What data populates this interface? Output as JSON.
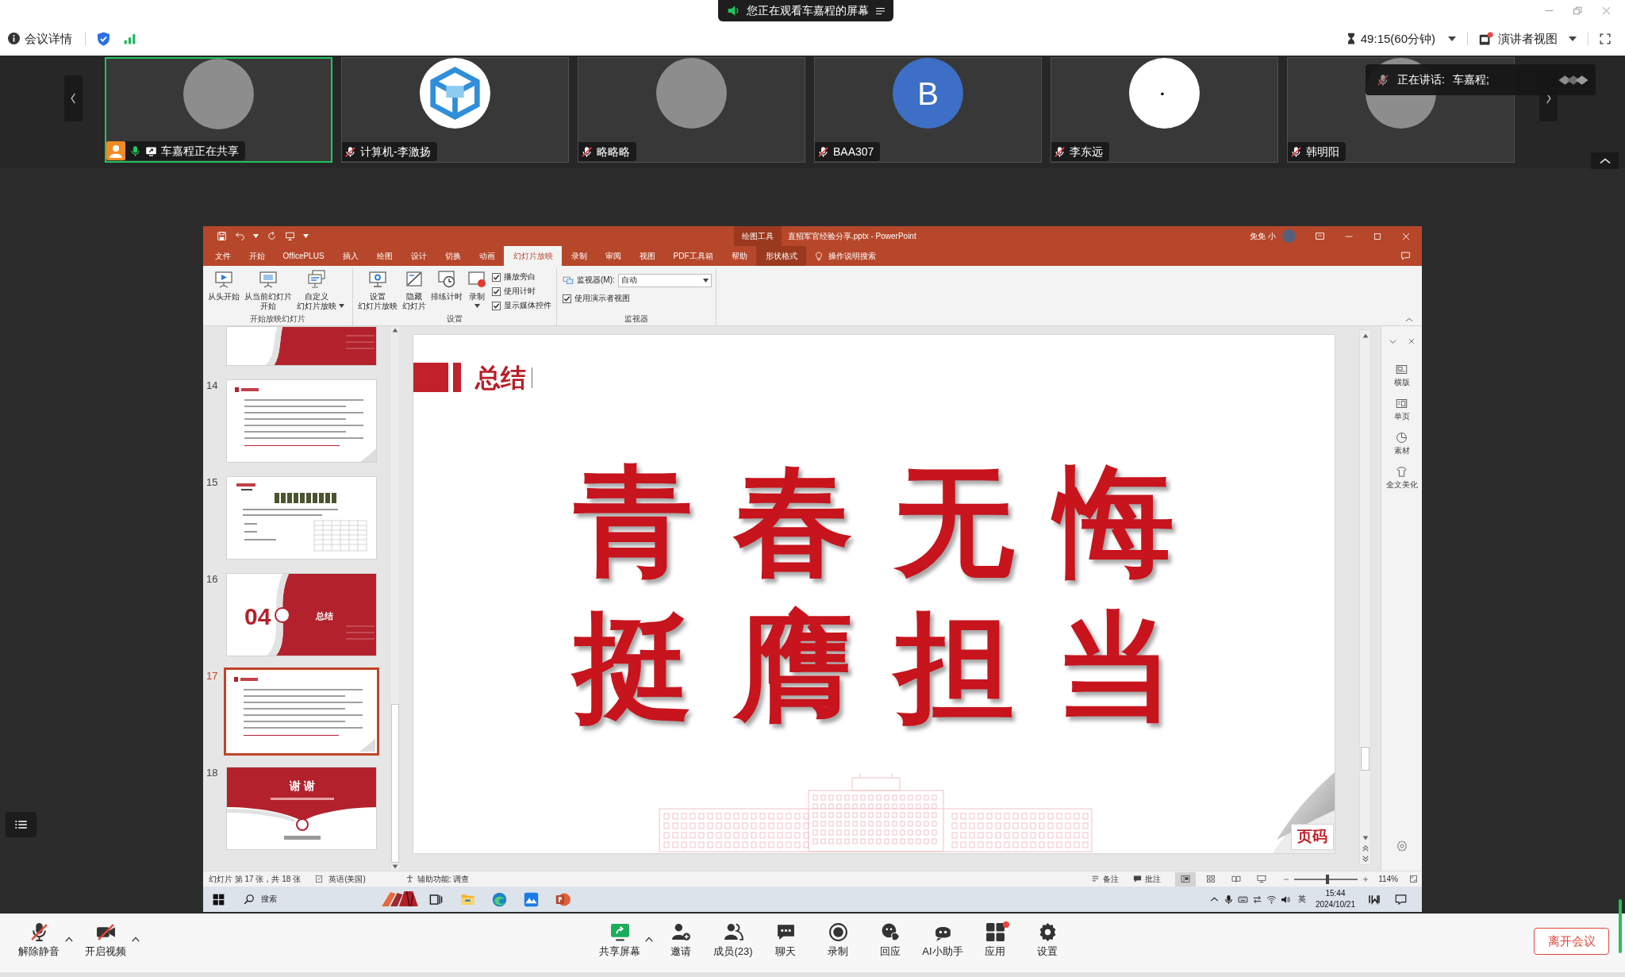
{
  "banner": {
    "text": "您正在观看车嘉程的屏幕"
  },
  "meeting_bar": {
    "info": "会议详情",
    "timer": "49:15(60分钟)",
    "view": "演讲者视图"
  },
  "participants": [
    {
      "name": "车嘉程正在共享",
      "kind": "photo",
      "speaking": true,
      "host": true,
      "muted": false,
      "sharing": true
    },
    {
      "name": "计算机-李激扬",
      "kind": "logo",
      "speaking": false,
      "host": false,
      "muted": true,
      "sharing": false
    },
    {
      "name": "略略略",
      "kind": "photo",
      "speaking": false,
      "host": false,
      "muted": true,
      "sharing": false
    },
    {
      "name": "BAA307",
      "kind": "letter",
      "letter": "B",
      "speaking": false,
      "host": false,
      "muted": true,
      "sharing": false
    },
    {
      "name": "李东远",
      "kind": "plain",
      "speaking": false,
      "host": false,
      "muted": true,
      "sharing": false
    },
    {
      "name": "韩明阳",
      "kind": "photo",
      "speaking": false,
      "host": false,
      "muted": true,
      "sharing": false
    }
  ],
  "speaker_notice": {
    "label": "正在讲话:",
    "name": "车嘉程;"
  },
  "powerpoint": {
    "context_group": "绘图工具",
    "title": "直招军官经验分享.pptx - PowerPoint",
    "user": "免免 小",
    "tabs": [
      {
        "label": "文件",
        "selected": false,
        "contextual": false
      },
      {
        "label": "开始",
        "selected": false,
        "contextual": false
      },
      {
        "label": "OfficePLUS",
        "selected": false,
        "contextual": false
      },
      {
        "label": "插入",
        "selected": false,
        "contextual": false
      },
      {
        "label": "绘图",
        "selected": false,
        "contextual": false
      },
      {
        "label": "设计",
        "selected": false,
        "contextual": false
      },
      {
        "label": "切换",
        "selected": false,
        "contextual": false
      },
      {
        "label": "动画",
        "selected": false,
        "contextual": false
      },
      {
        "label": "幻灯片放映",
        "selected": true,
        "contextual": false
      },
      {
        "label": "录制",
        "selected": false,
        "contextual": false
      },
      {
        "label": "审阅",
        "selected": false,
        "contextual": false
      },
      {
        "label": "视图",
        "selected": false,
        "contextual": false
      },
      {
        "label": "PDF工具箱",
        "selected": false,
        "contextual": false
      },
      {
        "label": "帮助",
        "selected": false,
        "contextual": false
      },
      {
        "label": "形状格式",
        "selected": false,
        "contextual": true
      }
    ],
    "tell_me": "操作说明搜索",
    "ribbon": [
      {
        "label": "开始放映幻灯片",
        "buttons": [
          {
            "lines": [
              "从头开始"
            ],
            "kind": "start",
            "dropdown": false
          },
          {
            "lines": [
              "从当前幻灯片",
              "开始"
            ],
            "kind": "current",
            "dropdown": false
          },
          {
            "lines": [
              "自定义",
              "幻灯片放映"
            ],
            "kind": "custom",
            "dropdown": true
          }
        ]
      },
      {
        "label": "设置",
        "buttons": [
          {
            "lines": [
              "设置",
              "幻灯片放映"
            ],
            "kind": "setup",
            "dropdown": false
          },
          {
            "lines": [
              "隐藏",
              "幻灯片"
            ],
            "kind": "hide",
            "dropdown": false
          },
          {
            "lines": [
              "排练计时"
            ],
            "kind": "rehearse",
            "dropdown": false
          },
          {
            "lines": [
              "录制"
            ],
            "kind": "record",
            "dropdown": true
          }
        ],
        "checks": [
          {
            "label": "播放旁白",
            "checked": true
          },
          {
            "label": "使用计时",
            "checked": true
          },
          {
            "label": "显示媒体控件",
            "checked": true
          }
        ]
      },
      {
        "label": "监视器",
        "monitor": {
          "label": "监视器(M):",
          "value": "自动"
        },
        "checks": [
          {
            "label": "使用演示者视图",
            "checked": true
          }
        ]
      }
    ],
    "thumbnails": [
      {
        "kind": "section",
        "cut": true,
        "selected": false
      },
      {
        "number": "14",
        "kind": "text",
        "cut": false,
        "selected": false
      },
      {
        "number": "15",
        "kind": "table",
        "cut": false,
        "selected": false
      },
      {
        "number": "16",
        "kind": "section",
        "cut": false,
        "selected": false,
        "big": "04",
        "title": "总结"
      },
      {
        "number": "17",
        "kind": "text",
        "cut": false,
        "selected": true
      },
      {
        "number": "18",
        "kind": "closing",
        "cut": false,
        "selected": false,
        "title": "谢 谢"
      }
    ],
    "slide": {
      "title": "总结",
      "lines": [
        "青 春 无 悔",
        "挺 膺 担 当"
      ],
      "page_label": "页码"
    },
    "task_pane": [
      {
        "kind": "layout",
        "label": "横版"
      },
      {
        "kind": "page",
        "label": "单页"
      },
      {
        "kind": "assets",
        "label": "素材"
      },
      {
        "kind": "beautify",
        "label": "全文美化"
      }
    ],
    "status_bar": {
      "slide_info": "幻灯片 第 17 张，共 18 张",
      "language": "英语(美国)",
      "accessibility": "辅助功能: 调查",
      "notes": "备注",
      "comments": "批注",
      "views": [
        {
          "kind": "normal",
          "selected": true
        },
        {
          "kind": "sorter",
          "selected": false
        },
        {
          "kind": "reading",
          "selected": false
        },
        {
          "kind": "slideshow",
          "selected": false
        }
      ],
      "zoom_slider": {
        "level": 0.52
      },
      "zoom": "114%"
    }
  },
  "taskbar": {
    "search": {
      "placeholder": "搜索"
    },
    "ime": "英",
    "time": "15:44",
    "date": "2024/10/21"
  },
  "toolbar": {
    "left": [
      {
        "label": "解除静音",
        "kind": "mic",
        "menu": true,
        "badge": false
      },
      {
        "label": "开启视频",
        "kind": "video",
        "menu": true,
        "badge": false
      }
    ],
    "center": [
      {
        "label": "共享屏幕",
        "kind": "share",
        "menu": true,
        "badge": false
      },
      {
        "label": "邀请",
        "kind": "invite",
        "menu": false,
        "badge": false
      },
      {
        "label": "成员(23)",
        "kind": "members",
        "menu": false,
        "badge": false
      },
      {
        "label": "聊天",
        "kind": "chat",
        "menu": false,
        "badge": false
      },
      {
        "label": "录制",
        "kind": "record",
        "menu": false,
        "badge": false
      },
      {
        "label": "回应",
        "kind": "react",
        "menu": false,
        "badge": false
      },
      {
        "label": "AI小助手",
        "kind": "assistant",
        "menu": false,
        "badge": false
      },
      {
        "label": "应用",
        "kind": "apps",
        "menu": false,
        "badge": true
      },
      {
        "label": "设置",
        "kind": "settings",
        "menu": false,
        "badge": false
      }
    ],
    "leave": "离开会议"
  }
}
